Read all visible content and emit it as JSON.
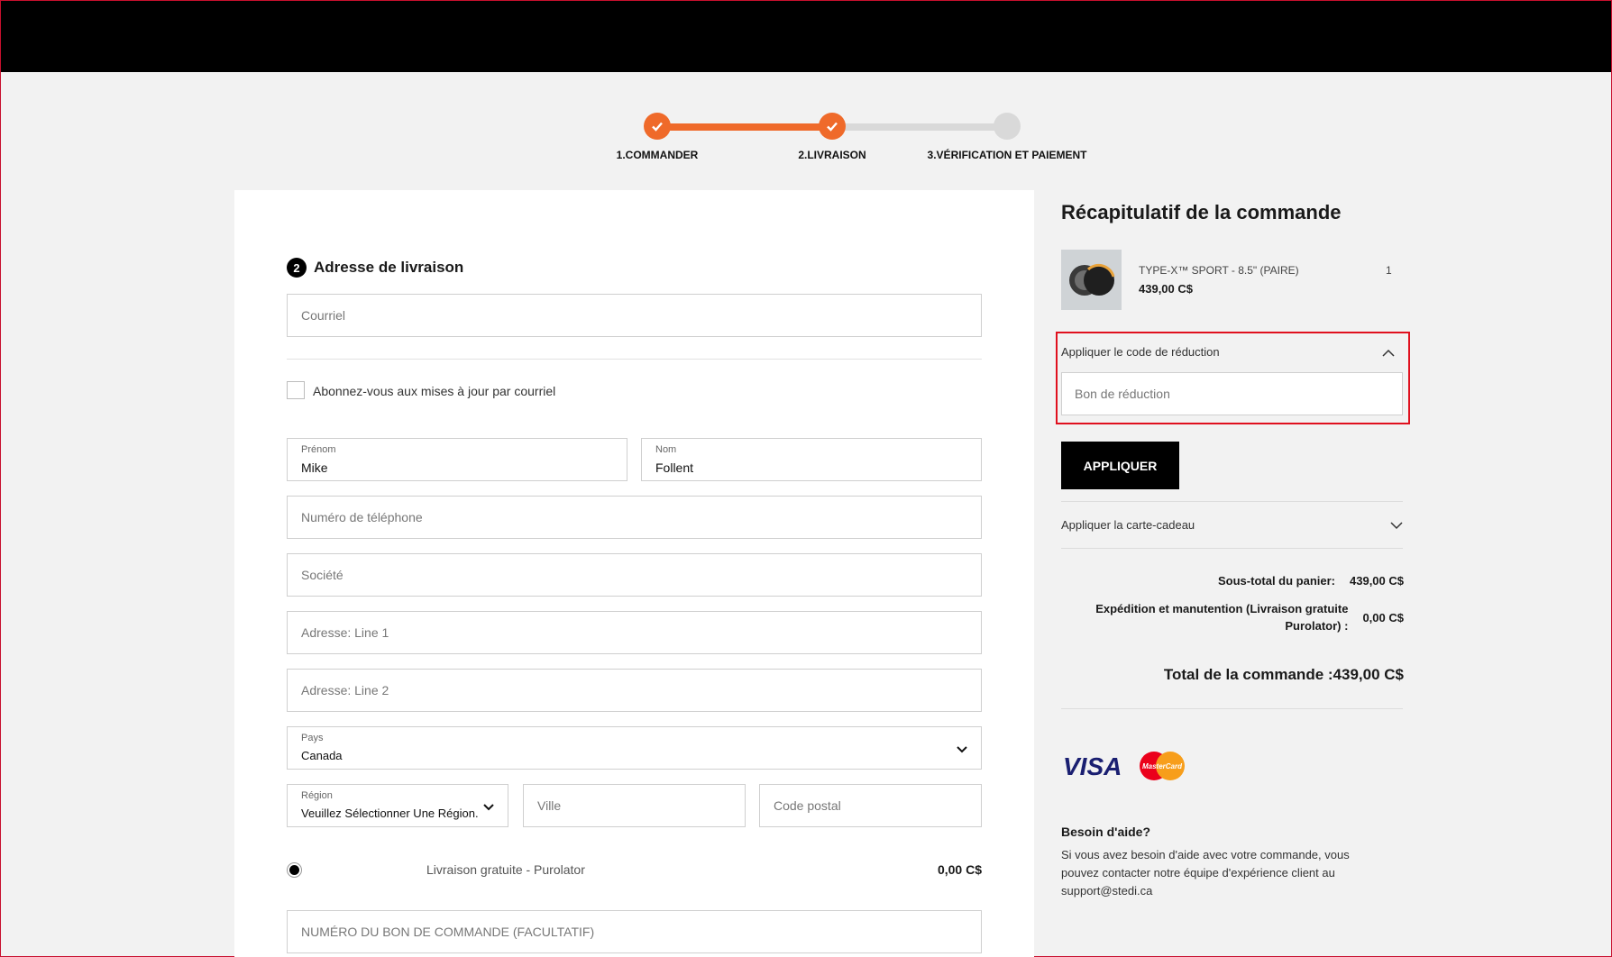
{
  "steps": [
    {
      "label": "1.COMMANDER",
      "state": "done"
    },
    {
      "label": "2.LIVRAISON",
      "state": "done"
    },
    {
      "label": "3.VÉRIFICATION ET PAIEMENT",
      "state": "todo"
    }
  ],
  "colors": {
    "accent": "#ef6a2a",
    "highlight": "#e0101e",
    "black": "#000000"
  },
  "form": {
    "section_number": "2",
    "section_title": "Adresse de livraison",
    "email_placeholder": "Courriel",
    "subscribe_label": "Abonnez-vous aux mises à jour par courriel",
    "first_name_label": "Prénom",
    "first_name_value": "Mike",
    "last_name_label": "Nom",
    "last_name_value": "Follent",
    "phone_placeholder": "Numéro de téléphone",
    "company_placeholder": "Société",
    "address1_placeholder": "Adresse: Line 1",
    "address2_placeholder": "Adresse: Line 2",
    "country_label": "Pays",
    "country_value": "Canada",
    "region_label": "Région",
    "region_value": "Veuillez Sélectionner Une Région.",
    "city_placeholder": "Ville",
    "postal_placeholder": "Code postal",
    "shipping_option_label": "Livraison gratuite - Purolator",
    "shipping_option_price": "0,00 C$",
    "po_placeholder": "NUMÉRO DU BON DE COMMANDE (FACULTATIF)"
  },
  "summary": {
    "title": "Récapitulatif de la commande",
    "product_name": "TYPE-X™ SPORT - 8.5\" (PAIRE)",
    "product_qty": "1",
    "product_price": "439,00 C$",
    "promo_heading": "Appliquer le code de réduction",
    "promo_placeholder": "Bon de réduction",
    "apply_label": "APPLIQUER",
    "gift_heading": "Appliquer la carte-cadeau",
    "subtotal_label": "Sous-total du panier:",
    "subtotal_value": "439,00 C$",
    "shipping_label": "Expédition et manutention (Livraison gratuite Purolator) :",
    "shipping_value": "0,00 C$",
    "total_label": "Total de la commande :",
    "total_value": "439,00 C$",
    "help_title": "Besoin d'aide?",
    "help_text": "Si vous avez besoin d'aide avec votre commande, vous pouvez contacter notre équipe d'expérience client au support@stedi.ca",
    "card_brands": [
      "VISA",
      "MasterCard"
    ]
  }
}
